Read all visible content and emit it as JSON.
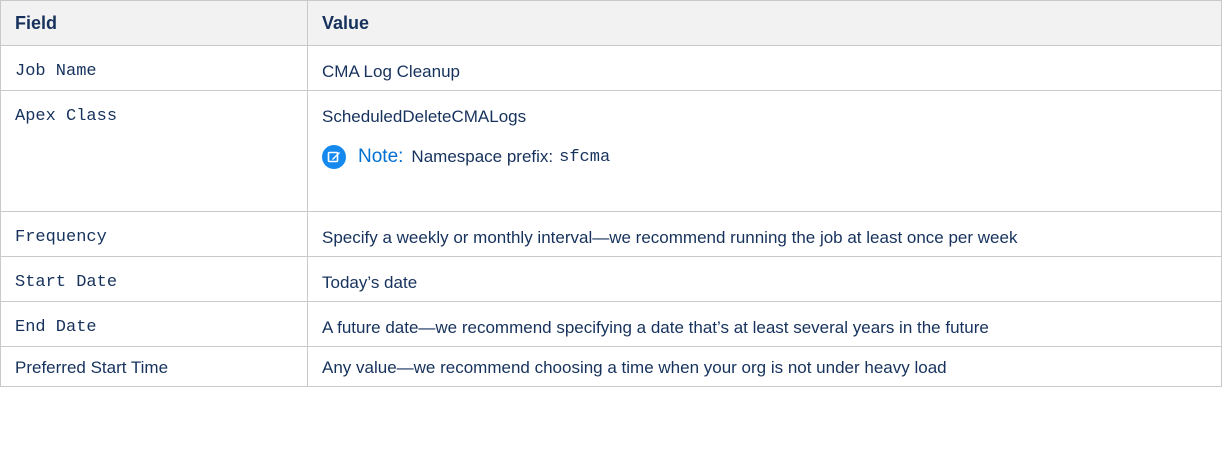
{
  "table": {
    "headers": {
      "field": "Field",
      "value": "Value"
    },
    "rows": [
      {
        "field": "Job Name",
        "value": "CMA Log Cleanup"
      },
      {
        "field": "Apex Class",
        "value": "ScheduledDeleteCMALogs",
        "note": {
          "label": "Note:",
          "text": "Namespace prefix:",
          "code": "sfcma"
        }
      },
      {
        "field": "Frequency",
        "value": "Specify a weekly or monthly interval—we recommend running the job at least once per week"
      },
      {
        "field": "Start Date",
        "value": "Today’s date"
      },
      {
        "field": "End Date",
        "value": "A future date—we recommend specifying a date that’s at least several years in the future"
      },
      {
        "field": "Preferred Start Time",
        "value": "Any value—we recommend choosing a time when your org is not under heavy load"
      }
    ]
  },
  "colors": {
    "header_bg": "#f3f2f2",
    "border": "#c9c9c9",
    "text": "#16325c",
    "note_accent": "#0070d2",
    "note_icon_bg": "#1589ee"
  },
  "icons": {
    "note": "edit-note-icon"
  }
}
